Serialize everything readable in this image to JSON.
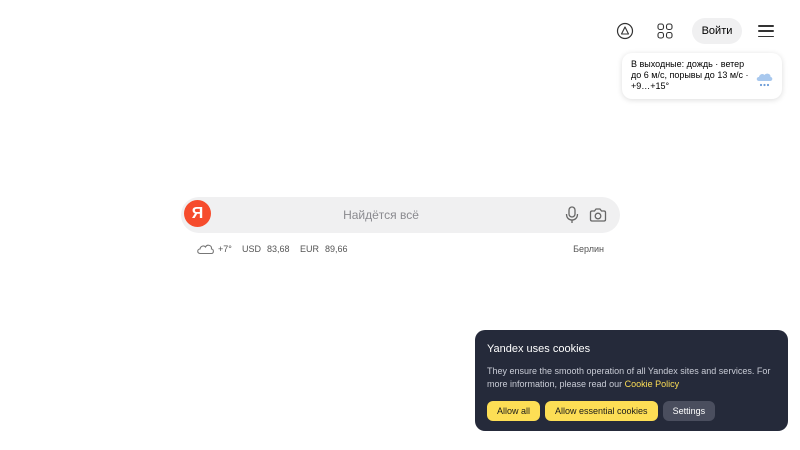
{
  "header": {
    "alice_icon": "alice-assistant-icon",
    "apps_icon": "apps-grid-icon",
    "login_label": "Войти",
    "menu_icon": "hamburger-menu-icon"
  },
  "weather_card": {
    "text": "В выходные: дождь · ветер до 6 м/с, порывы до 13 м/с · +9…+15°",
    "icon": "rain-cloud-icon"
  },
  "search": {
    "logo_letter": "Я",
    "placeholder": "Найдётся всё",
    "value": "",
    "mic_icon": "microphone-icon",
    "camera_icon": "camera-search-icon"
  },
  "informers": {
    "weather_temp": "+7°",
    "weather_icon": "cloudy-weather-icon",
    "usd_label": "USD",
    "usd_value": "83,68",
    "eur_label": "EUR",
    "eur_value": "89,66",
    "city": "Берлин"
  },
  "cookie_banner": {
    "title": "Yandex uses cookies",
    "text": "They ensure the smooth operation of all Yandex sites and services. For more information, please read our",
    "link_text": "Cookie Policy",
    "allow_all": "Allow all",
    "allow_essential": "Allow essential cookies",
    "settings": "Settings"
  },
  "colors": {
    "logo_red": "#f64c2d",
    "cookie_bg": "#252a3a",
    "accent_yellow": "#fdde55",
    "search_bg": "#f0f0f1"
  }
}
